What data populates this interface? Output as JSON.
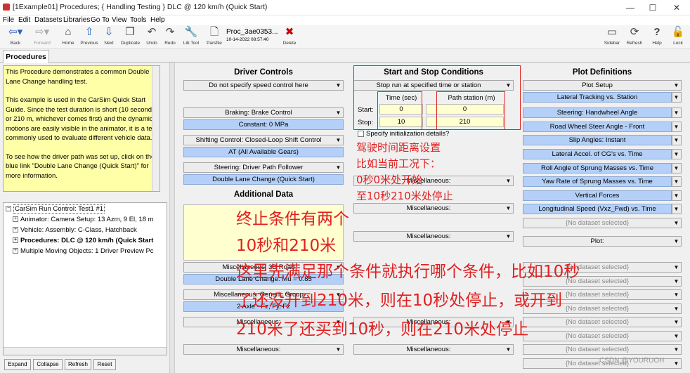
{
  "window": {
    "title": "[1Example01] Procedures; { Handling Testing } DLC @ 120 km/h (Quick Start)",
    "min": "—",
    "max": "☐",
    "close": "✕"
  },
  "menu": [
    "File",
    "Edit",
    "Datasets",
    "Libraries",
    "Go To",
    "View",
    "Tools",
    "Help"
  ],
  "toolbar": {
    "back": "Back",
    "forward": "Forward",
    "home": "Home",
    "previous": "Previous",
    "next": "Next",
    "duplicate": "Duplicate",
    "undo": "Undo",
    "redo": "Redo",
    "libtool": "Lib Tool",
    "parsfile": "Parsfile",
    "dataset_name": "Proc_3ae0353...",
    "dataset_date": "10-14-2022 08:57:40",
    "delete": "Delete",
    "sidebar": "Sidebar",
    "refresh": "Refresh",
    "help": "Help",
    "lock": "Lock"
  },
  "tab": "Procedures",
  "description": [
    "This Procedure demonstrates a common Double Lane Change handling test.",
    "This example is used in the CarSim Quick Start Guide. Since the test duration is short (10 seconds or 210 m, whichever comes first) and the dynamic motions are easily visible in the animator, it is a test commonly used to evaluate different vehicle data.",
    "To see how the driver path was set up, click on the blue link \"Double Lane Change (Quick Start)\" for more information."
  ],
  "tree": {
    "root": "CarSim Run Control: Test1 #1",
    "items": [
      "Animator: Camera Setup: 13 Azm, 9 El, 18 m",
      "Vehicle: Assembly: C-Class, Hatchback",
      "Procedures: DLC @ 120 km/h (Quick Start",
      "Multiple Moving Objects: 1 Driver Preview Pc"
    ]
  },
  "bottom_buttons": [
    "Expand",
    "Collapse",
    "Refresh",
    "Reset"
  ],
  "driver": {
    "title": "Driver Controls",
    "speed": "Do not specify speed control here",
    "braking": "Braking: Brake Control",
    "braking_val": "Constant: 0 MPa",
    "shifting": "Shifting Control: Closed-Loop Shift Control",
    "shifting_val": "AT (All Available Gears)",
    "steering": "Steering: Driver Path Follower",
    "steering_val": "Double Lane Change (Quick Start)"
  },
  "additional": {
    "title": "Additional Data",
    "misc1": "Miscellaneous:",
    "misc2": "Miscellaneous:",
    "misc_sd": "Miscellaneous: 3D Road",
    "misc_sd_val": "Double Lane Change: Mu = 0.85",
    "misc_gen": "Miscellaneous: Generic Group",
    "misc_gen_val": "2 Axle - Fz, Fy, Fz",
    "misc3": "Miscellaneous:",
    "misc4": "Miscellaneous:"
  },
  "stop": {
    "title": "Start and Stop Conditions",
    "mode": "Stop run at specified time or station",
    "col_time": "Time (sec)",
    "col_station": "Path station (m)",
    "start_label": "Start:",
    "stop_label": "Stop:",
    "start_time": "0",
    "start_station": "0",
    "stop_time": "10",
    "stop_station": "210",
    "init": "Specify initialization details?",
    "misc": [
      "Miscellaneous:",
      "Miscellaneous:",
      "Miscellaneous:",
      "Miscellaneous:",
      "Miscellaneous:"
    ]
  },
  "plot": {
    "title": "Plot Definitions",
    "setup": "Plot Setup",
    "items": [
      "Lateral Tracking vs. Station",
      "Steering: Handwheel Angle",
      "Road Wheel Steer Angle - Front",
      "Slip Angles: Instant",
      "Lateral Accel. of CG's vs. Time",
      "Roll Angle of Sprung Masses vs. Time",
      "Yaw Rate of Sprung Masses vs. Time",
      "Vertical Forces",
      "Longitudinal Speed (Vxz_Fwd) vs. Time"
    ],
    "empty": "{No dataset selected}",
    "plot_label": "Plot:"
  },
  "annotations": {
    "a1": "驾驶时间距离设置",
    "a2": "比如当前工况下：",
    "a3": "0秒0米处开始",
    "a4": "至10秒210米处停止",
    "b1": "终止条件有两个",
    "b2": "10秒和210米",
    "c1": "这里先满足那个条件就执行哪个条件，比如10秒",
    "c2": "了还没开到210米，则在10秒处停止，或开到",
    "c3": "210米了还买到10秒，则在210米处停止"
  },
  "watermark": "CSDN @YOURUOH",
  "colors": {
    "annotation": "#e02020",
    "highlight": "#b4d0f8",
    "yellow": "#ffffa8"
  }
}
